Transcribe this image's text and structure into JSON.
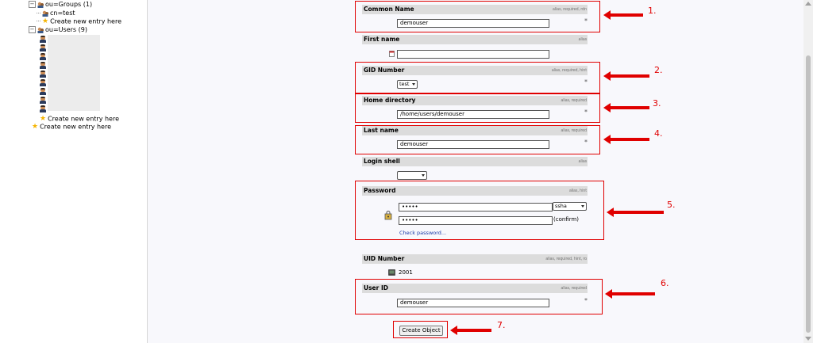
{
  "tree": {
    "groups_label": "ou=Groups (1)",
    "group_child": "cn=test",
    "create_entry_groups": "Create new entry here",
    "users_label": "ou=Users (9)",
    "create_entry_users": "Create new entry here",
    "create_entry_root": "Create new entry here",
    "expand_symbol": "−"
  },
  "form": {
    "common_name": {
      "label": "Common Name",
      "hint": "alias, required, rdn",
      "value": "demouser"
    },
    "first_name": {
      "label": "First name",
      "hint": "alias",
      "value": ""
    },
    "gid_number": {
      "label": "GID Number",
      "hint": "alias, required, hint",
      "value": "test"
    },
    "home_directory": {
      "label": "Home directory",
      "hint": "alias, required",
      "value": "/home/users/demouser"
    },
    "last_name": {
      "label": "Last name",
      "hint": "alias, required",
      "value": "demouser"
    },
    "login_shell": {
      "label": "Login shell",
      "hint": "alias",
      "value": ""
    },
    "password": {
      "label": "Password",
      "hint": "alias, hint",
      "value": "•••••",
      "confirm_value": "•••••",
      "hash": "ssha",
      "confirm_label": "(confirm)",
      "check_link": "Check password..."
    },
    "uid_number": {
      "label": "UID Number",
      "hint": "alias, required, hint, ro",
      "value": "2001"
    },
    "user_id": {
      "label": "User ID",
      "hint": "alias, required",
      "value": "demouser"
    },
    "required_marker": "*",
    "create_button": "Create Object"
  },
  "annotations": [
    "1.",
    "2.",
    "3.",
    "4.",
    "5.",
    "6.",
    "7."
  ],
  "colors": {
    "annotation": "#e00000",
    "header_bg": "#dcdcdc",
    "panel_bg": "#f8f8fc"
  }
}
